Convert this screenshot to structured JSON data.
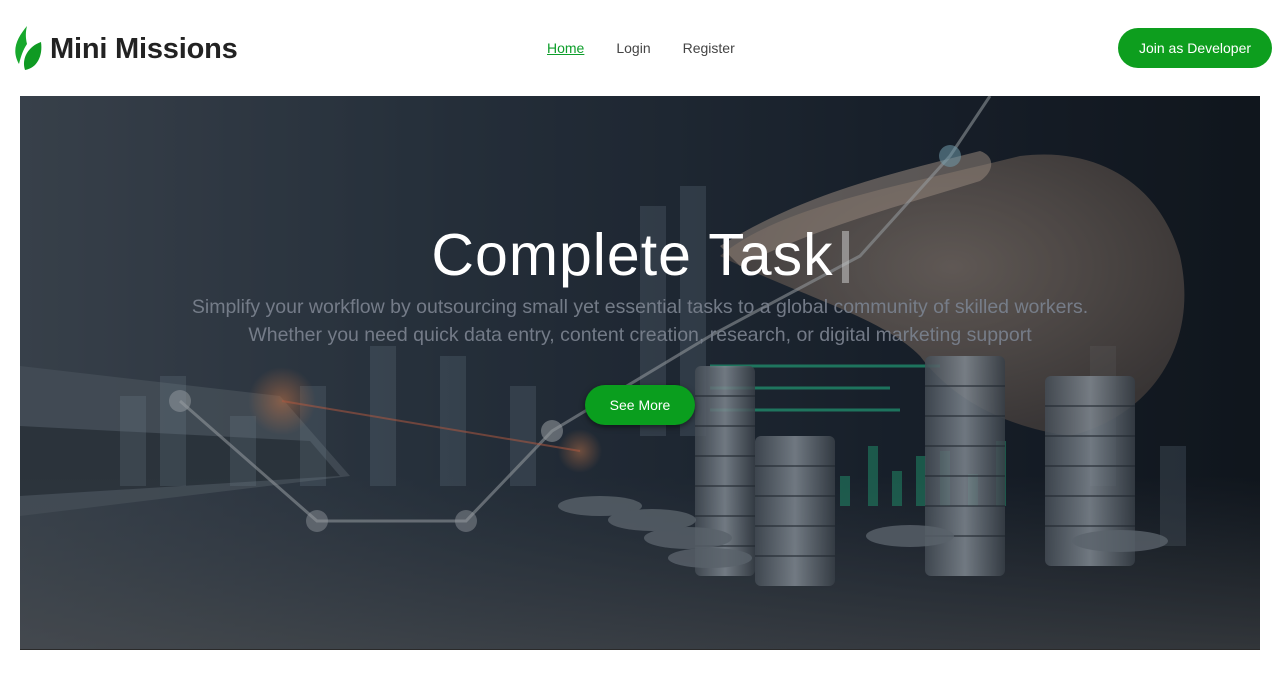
{
  "header": {
    "logo_icon": "leaf-icon",
    "brand": "Mini Missions",
    "nav": [
      {
        "label": "Home",
        "active": true
      },
      {
        "label": "Login",
        "active": false
      },
      {
        "label": "Register",
        "active": false
      }
    ],
    "cta_label": "Join as Developer"
  },
  "hero": {
    "title": "Complete Task",
    "subtitle": "Simplify your workflow by outsourcing small yet essential tasks to a global community of skilled workers. Whether you need quick data entry, content creation, research, or digital marketing support",
    "button_label": "See More"
  },
  "colors": {
    "accent": "#0d9e1e",
    "nav_active": "#0d9e2a",
    "brand_text": "#222222"
  }
}
